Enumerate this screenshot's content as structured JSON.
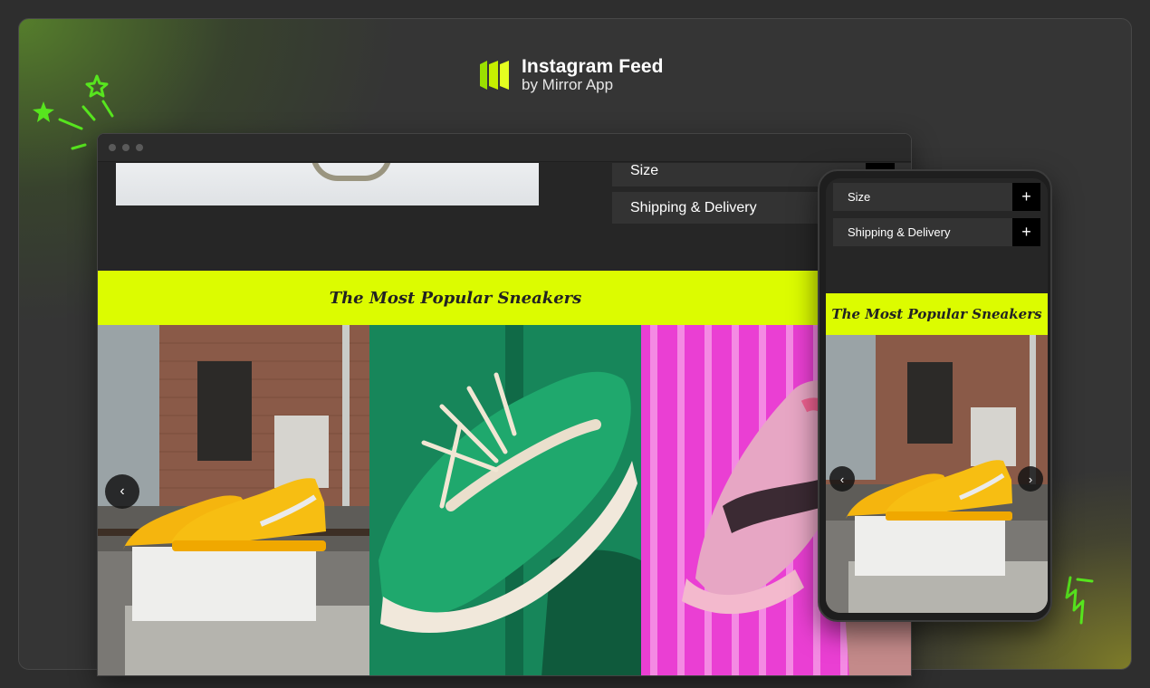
{
  "brand": {
    "title": "Instagram Feed",
    "subtitle": "by Mirror App",
    "logo_color": "#c6f000"
  },
  "desktop": {
    "accordion": [
      {
        "label": "Size",
        "icon": "plus-icon"
      },
      {
        "label": "Shipping & Delivery",
        "icon": "plus-icon"
      }
    ],
    "banner_title": "The Most Popular Sneakers",
    "banner_color": "#dcfc00",
    "gallery": [
      {
        "name": "yellow-sneakers-photo",
        "icon": "photo"
      },
      {
        "name": "green-sneaker-photo",
        "icon": "photo"
      },
      {
        "name": "pink-sneaker-photo",
        "icon": "photo"
      }
    ],
    "prev_icon": "‹"
  },
  "mobile": {
    "accordion": [
      {
        "label": "Size",
        "icon": "plus-icon"
      },
      {
        "label": "Shipping & Delivery",
        "icon": "plus-icon"
      }
    ],
    "banner_title": "The Most Popular Sneakers",
    "prev_icon": "‹",
    "next_icon": "›"
  },
  "accent_color": "#57e51e"
}
